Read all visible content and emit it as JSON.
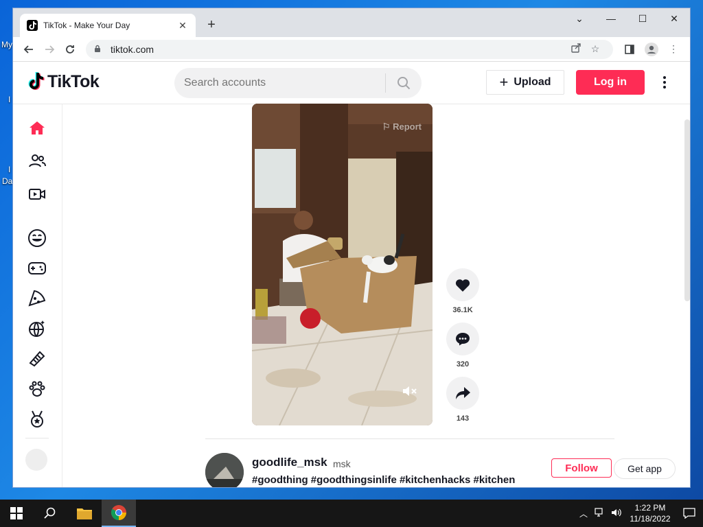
{
  "desktop": {
    "frag1": "My",
    "frag2": "I",
    "frag3": "Da"
  },
  "browser": {
    "tab_title": "TikTok - Make Your Day",
    "url": "tiktok.com"
  },
  "header": {
    "logo": "TikTok",
    "search_placeholder": "Search accounts",
    "upload_label": "Upload",
    "login_label": "Log in"
  },
  "sidebar": {
    "items": [
      "home-icon",
      "following-icon",
      "live-icon",
      "comedy-icon",
      "gaming-icon",
      "food-icon",
      "sports-icon",
      "beauty-icon",
      "animals-icon",
      "achievement-icon"
    ]
  },
  "video": {
    "report_label": "Report"
  },
  "actions": {
    "likes": "36.1K",
    "comments": "320",
    "shares": "143"
  },
  "post": {
    "username": "goodlife_msk",
    "nickname": "msk",
    "hashtags": "#goodthing #goodthingsinlife #kitchenhacks #kitchen",
    "follow_label": "Follow",
    "getapp_label": "Get app"
  },
  "taskbar": {
    "time": "1:22 PM",
    "date": "11/18/2022"
  },
  "colors": {
    "brand": "#fe2c55",
    "accent_text": "#161823"
  }
}
